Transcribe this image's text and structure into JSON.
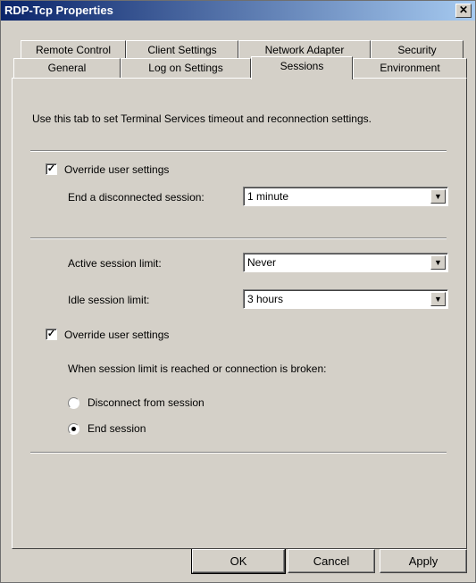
{
  "window": {
    "title": "RDP-Tcp Properties",
    "close_glyph": "✕"
  },
  "tabs": {
    "row1": [
      "Remote Control",
      "Client Settings",
      "Network Adapter",
      "Security"
    ],
    "row2": [
      "General",
      "Log on Settings",
      "Sessions",
      "Environment"
    ],
    "active": "Sessions"
  },
  "sessions": {
    "intro": "Use this tab to set Terminal Services timeout and reconnection settings.",
    "override1": {
      "label": "Override user settings",
      "checked": true
    },
    "end_disconnected": {
      "label": "End a disconnected session:",
      "value": "1 minute"
    },
    "active_limit": {
      "label": "Active session limit:",
      "value": "Never"
    },
    "idle_limit": {
      "label": "Idle session limit:",
      "value": "3 hours"
    },
    "override2": {
      "label": "Override user settings",
      "checked": true
    },
    "limit_text": "When session limit is reached or connection is broken:",
    "radio_disconnect": {
      "label": "Disconnect from session",
      "selected": false
    },
    "radio_end": {
      "label": "End session",
      "selected": true
    }
  },
  "buttons": {
    "ok": "OK",
    "cancel": "Cancel",
    "apply": "Apply"
  },
  "colors": {
    "face": "#d4d0c8",
    "title_start": "#0a246a",
    "title_end": "#a6caf0"
  }
}
